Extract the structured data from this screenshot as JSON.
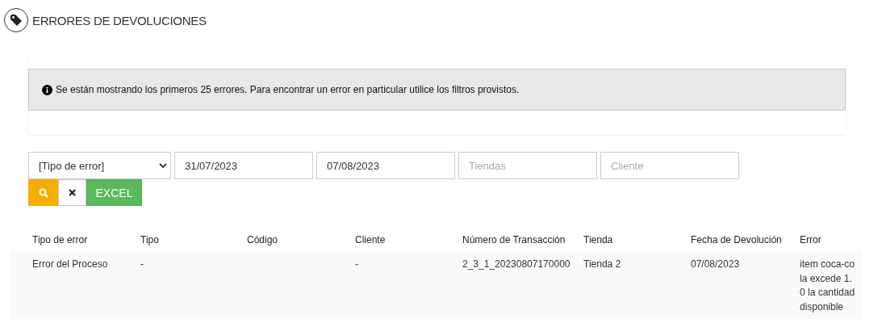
{
  "page": {
    "title": "ERRORES DE DEVOLUCIONES"
  },
  "alert": {
    "text": "Se están mostrando los primeros 25 errores. Para encontrar un error en particular utilice los filtros provistos."
  },
  "filters": {
    "error_type": {
      "value": "[Tipo de error]"
    },
    "date_from": {
      "value": "31/07/2023"
    },
    "date_to": {
      "value": "07/08/2023"
    },
    "stores": {
      "placeholder": "Tiendas"
    },
    "client": {
      "placeholder": "Cliente"
    }
  },
  "buttons": [
    {
      "kind": "search"
    },
    {
      "kind": "clear"
    },
    {
      "kind": "excel",
      "label": "EXCEL"
    }
  ],
  "table": {
    "columns": [
      "Tipo de error",
      "Tipo",
      "Código",
      "Cliente",
      "Número de Transacción",
      "Tienda",
      "Fecha de Devolución",
      "Error"
    ],
    "rows": [
      [
        "Error del Proceso",
        "-",
        "",
        "-",
        "2_3_1_20230807170000",
        "Tienda 2",
        "07/08/2023",
        "item coca-cola excede 1.0 la cantidad disponible"
      ]
    ]
  }
}
